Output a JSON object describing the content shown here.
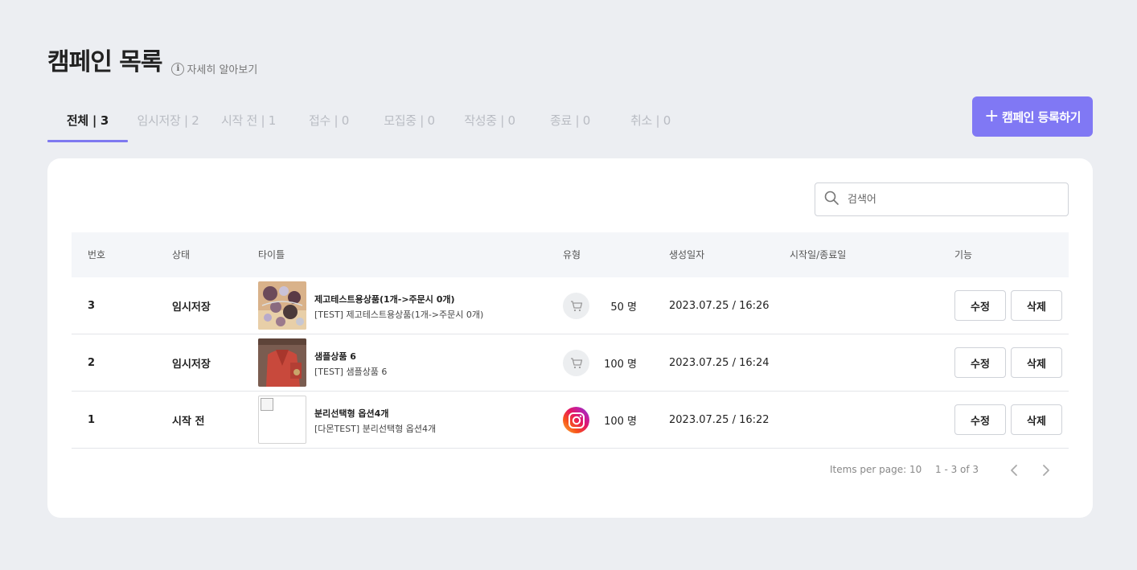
{
  "header": {
    "title": "캠페인 목록",
    "learn_more": "자세히 알아보기"
  },
  "tabs": [
    {
      "label": "전체 | 3",
      "active": true
    },
    {
      "label": "임시저장 | 2"
    },
    {
      "label": "시작 전 | 1"
    },
    {
      "label": "접수 | 0"
    },
    {
      "label": "모집중 | 0"
    },
    {
      "label": "작성중 | 0"
    },
    {
      "label": "종료 | 0"
    },
    {
      "label": "취소 | 0"
    }
  ],
  "register_button": {
    "label": "캠페인 등록하기"
  },
  "search": {
    "placeholder": "검색어"
  },
  "table": {
    "columns": [
      "번호",
      "상태",
      "타이틀",
      "유형",
      "생성일자",
      "시작일/종료일",
      "기능"
    ],
    "rows": [
      {
        "no": "3",
        "status": "임시저장",
        "title": "제고테스트용상품(1개->주문시 0개)",
        "subtitle": "[TEST] 제고테스트용상품(1개->주문시 0개)",
        "type_icon": "cart-icon",
        "count": "50 명",
        "created": "2023.07.25 / 16:26",
        "period": "",
        "edit": "수정",
        "delete": "삭제"
      },
      {
        "no": "2",
        "status": "임시저장",
        "title": "샘플상품 6",
        "subtitle": "[TEST] 샘플상품 6",
        "type_icon": "cart-icon",
        "count": "100 명",
        "created": "2023.07.25 / 16:24",
        "period": "",
        "edit": "수정",
        "delete": "삭제"
      },
      {
        "no": "1",
        "status": "시작 전",
        "title": "분리선택형 옵션4개",
        "subtitle": "[다몬TEST] 분리선택형 옵션4개",
        "type_icon": "instagram-icon",
        "count": "100 명",
        "created": "2023.07.25 / 16:22",
        "period": "",
        "edit": "수정",
        "delete": "삭제"
      }
    ]
  },
  "pagination": {
    "items_per_page": "Items per page: 10",
    "range": "1 - 3 of 3"
  },
  "colors": {
    "accent": "#8078f4",
    "background": "#eceef2",
    "tab_inactive": "#b9bcc3"
  }
}
